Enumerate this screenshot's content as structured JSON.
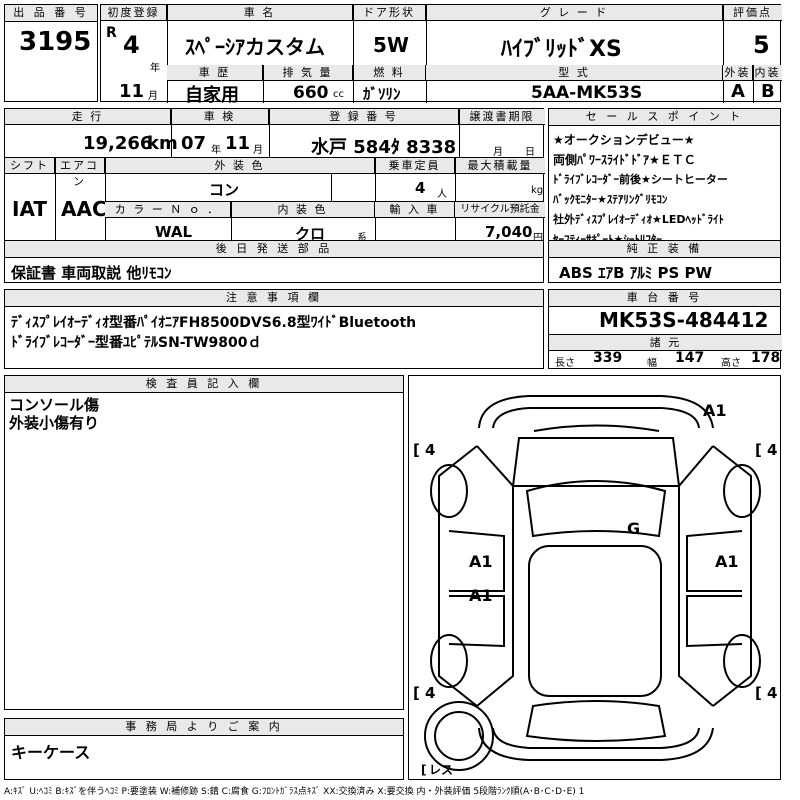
{
  "lot": {
    "label": "出 品 番 号",
    "value": "3195"
  },
  "first_reg": {
    "label": "初度登録",
    "era": "R",
    "year": "4",
    "year_unit": "年",
    "month": "11",
    "month_unit": "月"
  },
  "car_name": {
    "label": "車 名",
    "value": "ｽﾍﾟｰｼｱカスタム"
  },
  "door": {
    "label": "ドア形状",
    "value": "5W"
  },
  "grade": {
    "label": "グ レ ー ド",
    "value": "ﾊｲﾌﾞﾘｯﾄﾞXS"
  },
  "score": {
    "label": "評価点",
    "value": "5"
  },
  "history": {
    "label": "車 歴",
    "value": "自家用"
  },
  "displacement": {
    "label": "排 気 量",
    "value": "660",
    "unit": "cc"
  },
  "fuel": {
    "label": "燃 料",
    "value": "ｶﾞｿﾘﾝ"
  },
  "model": {
    "label": "型 式",
    "value": "5AA-MK53S"
  },
  "exterior_grade": {
    "label": "外装",
    "value": "A"
  },
  "interior_grade": {
    "label": "内装",
    "value": "B"
  },
  "mileage": {
    "label": "走 行",
    "value": "19,266",
    "unit": "km"
  },
  "inspection": {
    "label": "車 検",
    "year": "07",
    "year_unit": "年",
    "month": "11",
    "month_unit": "月"
  },
  "plate": {
    "label": "登 録 番 号",
    "value": "水戸 584ﾀ 8338"
  },
  "transfer": {
    "label": "譲渡書期限",
    "month_unit": "月",
    "day_unit": "日"
  },
  "shift": {
    "label": "シフト",
    "value": "IAT"
  },
  "ac": {
    "label": "エアコン",
    "value": "AAC"
  },
  "ext_color": {
    "label": "外 装 色",
    "value": "コン"
  },
  "capacity": {
    "label": "乗車定員",
    "value": "4",
    "unit": "人"
  },
  "max_load": {
    "label": "最大積載量",
    "unit": "kg"
  },
  "color_no": {
    "label": "カ ラ ー Ｎ ｏ ．",
    "value": "WAL"
  },
  "int_color": {
    "label": "内 装 色",
    "value": "クロ",
    "unit": "系"
  },
  "import": {
    "label": "輸 入 車"
  },
  "recycle": {
    "label": "リサイクル預託金",
    "value": "7,040",
    "unit": "円"
  },
  "sales_points": {
    "label": "セ ー ル ス ポ イ ン ト",
    "lines": [
      "★オークションデビュー★",
      "両側ﾊﾟﾜｰｽﾗｲﾄﾞﾄﾞｱ★ＥＴＣ",
      "ﾄﾞﾗｲﾌﾞﾚｺｰﾀﾞｰ前後★シートヒーター",
      "ﾊﾞｯｸﾓﾆﾀｰ★ｽﾃｱﾘﾝｸﾞﾘﾓｺﾝ",
      "社外ﾃﾞｨｽﾌﾟﾚｲｵｰﾃﾞｨｵ★LEDﾍｯﾄﾞﾗｲﾄ",
      "ｾｰﾌﾃｨｰｻﾎﾟｰﾄ★ｼｰﾄﾘﾌﾀｰ"
    ]
  },
  "later_parts": {
    "label": "後 日 発 送 部 品",
    "value": "保証書 車両取説 他ﾘﾓｺﾝ"
  },
  "genuine": {
    "label": "純 正 装 備",
    "value": "ABS ｴｱB ｱﾙﾐ PS PW"
  },
  "notes": {
    "label": "注 意 事 項 欄",
    "line1": "ﾃﾞｨｽﾌﾟﾚｲｵｰﾃﾞｨｵ型番ﾊﾟｲｵﾆｱFH8500DVS6.8型ﾜｲﾄﾞBluetooth",
    "line2": "ﾄﾞﾗｲﾌﾞﾚｺｰﾀﾞｰ型番ﾕﾋﾟﾃﾙSN-TW9800ｄ"
  },
  "chassis": {
    "label": "車 台 番 号",
    "value": "MK53S-484412"
  },
  "specs": {
    "label": "諸 元",
    "length_label": "長さ",
    "length": "339",
    "width_label": "幅",
    "width": "147",
    "height_label": "高さ",
    "height": "178"
  },
  "inspector": {
    "label": "検 査 員 記 入 欄",
    "line1": "コンソール傷",
    "line2": "外装小傷有り"
  },
  "office": {
    "label": "事 務 局 よ り ご 案 内",
    "value": "キーケース"
  },
  "diagram": {
    "marks": {
      "a1_top": "A1",
      "g": "G",
      "a1_left1": "A1",
      "a1_right": "A1",
      "a1_left2": "A1"
    },
    "tires": {
      "fl": "4",
      "fr": "4",
      "rl": "4",
      "rr": "4",
      "spare": "レス"
    }
  },
  "legend": "A:ｷｽﾞ U:ﾍｺﾐ B:ｷｽﾞを伴うﾍｺﾐ P:要塗装 W:補修跡 S:錆 C:腐食 G:ﾌﾛﾝﾄｶﾞﾗｽ点ｷｽﾞ XX:交換済み X:要交換 内・外装評価 5段階ﾗﾝｸ順(A･B･C･D･E) 1"
}
